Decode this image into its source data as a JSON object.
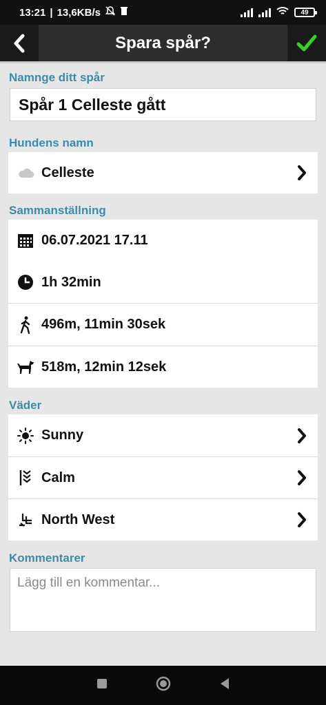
{
  "status": {
    "time": "13:21",
    "speed": "13,6KB/s",
    "battery": "49"
  },
  "appbar": {
    "title": "Spara spår?",
    "back_icon": "chevron-left-icon",
    "confirm_icon": "check-icon",
    "confirm_color": "#35d12a"
  },
  "track_name": {
    "label": "Namnge ditt spår",
    "value": "Spår 1 Celleste gått"
  },
  "dog": {
    "label": "Hundens namn",
    "name": "Celleste"
  },
  "summary": {
    "label": "Sammanställning",
    "date": "06.07.2021 17.11",
    "duration": "1h 32min",
    "walker": "496m, 11min 30sek",
    "dog": "518m, 12min 12sek"
  },
  "weather": {
    "label": "Väder",
    "condition": "Sunny",
    "wind": "Calm",
    "direction": "North West"
  },
  "comments": {
    "label": "Kommentarer",
    "placeholder": "Lägg till en kommentar..."
  },
  "colors": {
    "accent": "#3d8ba6",
    "appbar": "#2e2e2e"
  }
}
